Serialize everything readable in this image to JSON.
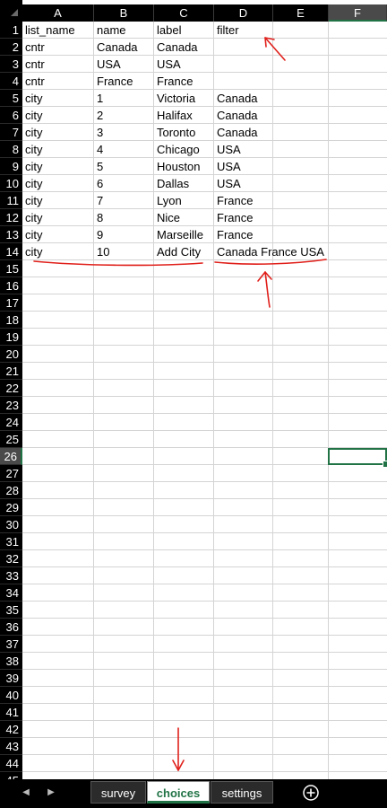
{
  "columns": [
    "A",
    "B",
    "C",
    "D",
    "E",
    "F"
  ],
  "selected_column": "F",
  "selected_row": 26,
  "rows": [
    "1",
    "2",
    "3",
    "4",
    "5",
    "6",
    "7",
    "8",
    "9",
    "10",
    "11",
    "12",
    "13",
    "14",
    "15",
    "16",
    "17",
    "18",
    "19",
    "20",
    "21",
    "22",
    "23",
    "24",
    "25",
    "26",
    "27",
    "28",
    "29",
    "30",
    "31",
    "32",
    "33",
    "34",
    "35",
    "36",
    "37",
    "38",
    "39",
    "40",
    "41",
    "42",
    "43",
    "44",
    "45"
  ],
  "cells": [
    [
      "list_name",
      "name",
      "label",
      "filter"
    ],
    [
      "cntr",
      "Canada",
      "Canada",
      ""
    ],
    [
      "cntr",
      "USA",
      "USA",
      ""
    ],
    [
      "cntr",
      "France",
      "France",
      ""
    ],
    [
      "city",
      "1",
      "Victoria",
      "Canada"
    ],
    [
      "city",
      "2",
      "Halifax",
      "Canada"
    ],
    [
      "city",
      "3",
      "Toronto",
      "Canada"
    ],
    [
      "city",
      "4",
      "Chicago",
      "USA"
    ],
    [
      "city",
      "5",
      "Houston",
      "USA"
    ],
    [
      "city",
      "6",
      "Dallas",
      "USA"
    ],
    [
      "city",
      "7",
      "Lyon",
      "France"
    ],
    [
      "city",
      "8",
      "Nice",
      "France"
    ],
    [
      "city",
      "9",
      "Marseille",
      "France"
    ],
    [
      "city",
      "10",
      "Add City",
      "Canada France USA"
    ]
  ],
  "sheet_tabs": [
    {
      "label": "survey",
      "active": false
    },
    {
      "label": "choices",
      "active": true
    },
    {
      "label": "settings",
      "active": false
    }
  ],
  "nav": {
    "prev_icon": "triangle-left-icon",
    "next_icon": "triangle-right-icon",
    "add_icon": "plus-circle-icon"
  },
  "colors": {
    "accent": "#217346",
    "annotation": "#e0201b",
    "header_bg": "#000000",
    "gridline": "#d4d4d4"
  }
}
